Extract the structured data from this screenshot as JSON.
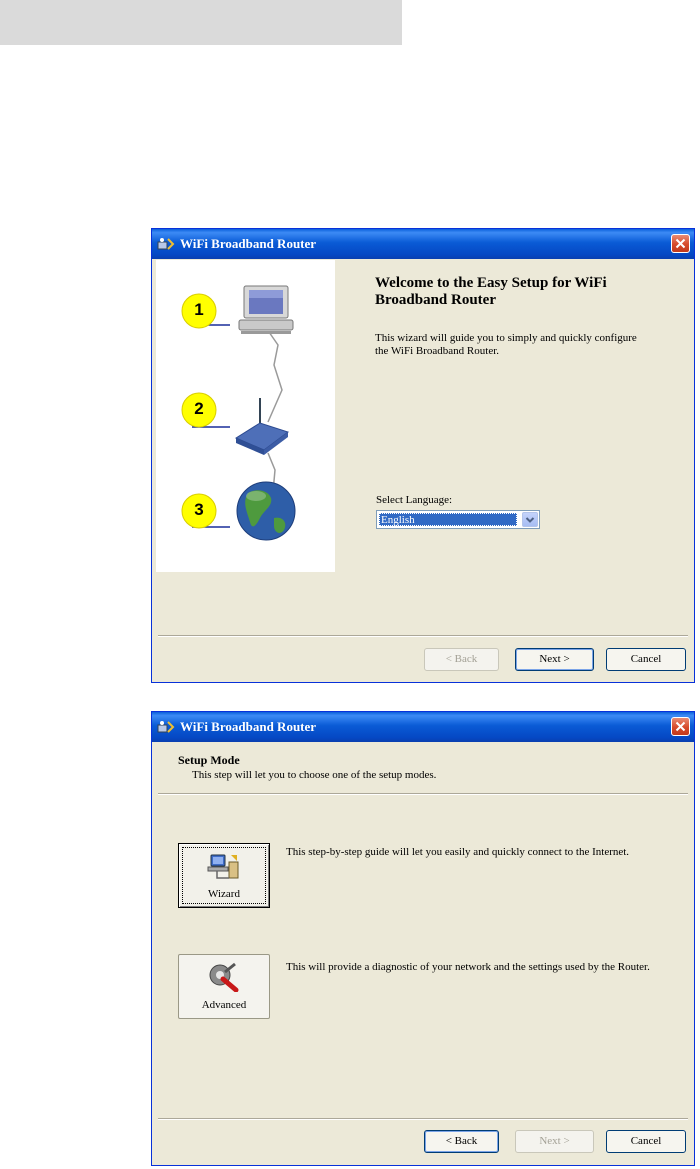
{
  "window1": {
    "title": "WiFi Broadband Router",
    "heading": "Welcome to the Easy Setup for WiFi Broadband Router",
    "description": "This wizard will guide you to simply and quickly configure the WiFi Broadband Router.",
    "steps": [
      "1",
      "2",
      "3"
    ],
    "language_label": "Select Language:",
    "language_value": "English",
    "back_label": "< Back",
    "next_label": "Next >",
    "cancel_label": "Cancel"
  },
  "window2": {
    "title": "WiFi Broadband Router",
    "section_title": "Setup Mode",
    "section_subtitle": "This step will let you to choose one of the setup modes.",
    "wizard_label": "Wizard",
    "wizard_description": "This step-by-step guide will let you easily and quickly connect to the Internet.",
    "advanced_label": "Advanced",
    "advanced_description": "This will provide a diagnostic of your network and the settings used by the Router.",
    "back_label": "< Back",
    "next_label": "Next >",
    "cancel_label": "Cancel"
  },
  "colors": {
    "title_bar": "#0a5bd6",
    "dialog_bg": "#ece9d8",
    "step_badge": "#ffff00",
    "close_red": "#d64a2a"
  }
}
